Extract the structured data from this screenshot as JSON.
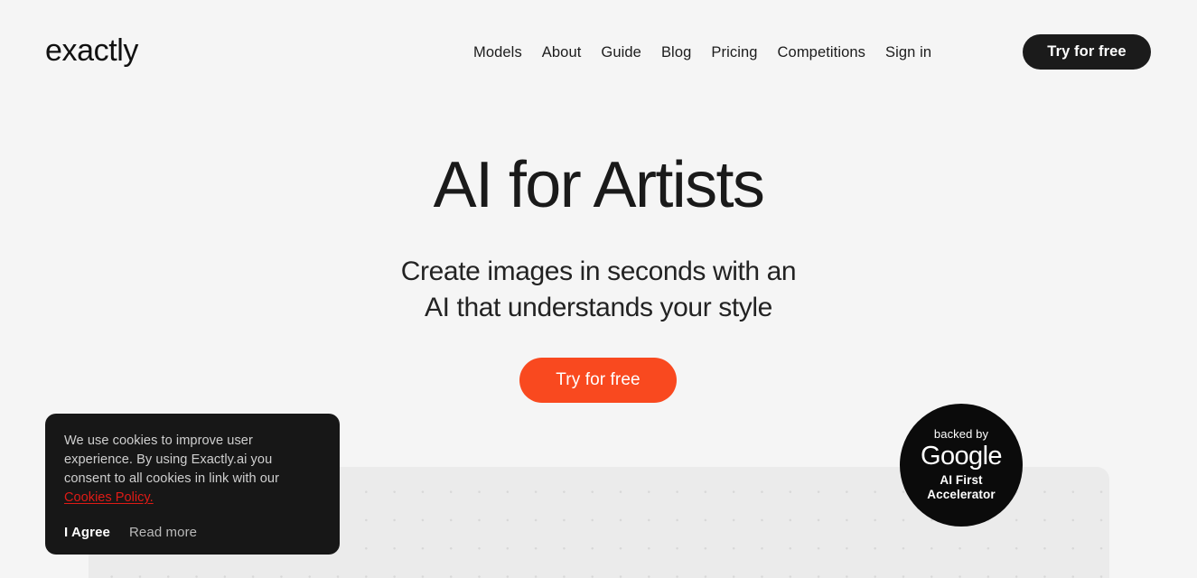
{
  "header": {
    "logo": "exactly",
    "nav_items": [
      {
        "label": "Models"
      },
      {
        "label": "About"
      },
      {
        "label": "Guide"
      },
      {
        "label": "Blog"
      },
      {
        "label": "Pricing"
      },
      {
        "label": "Competitions"
      },
      {
        "label": "Sign in"
      }
    ],
    "cta_label": "Try for free"
  },
  "hero": {
    "title": "AI for Artists",
    "subtitle_line1": "Create images in seconds with an",
    "subtitle_line2": "AI that understands your style",
    "cta_label": "Try for free"
  },
  "badge": {
    "backed_by": "backed by",
    "brand": "Google",
    "program_line1": "AI First",
    "program_line2": "Accelerator"
  },
  "cookie_banner": {
    "text": "We use cookies to improve user experience. By using Exactly.ai you consent to all cookies in link with our",
    "policy_link": "Cookies Policy.",
    "agree_label": "I Agree",
    "read_more_label": "Read more"
  },
  "colors": {
    "page_background": "#f5f5f5",
    "panel_background": "#ebebeb",
    "panel_dot": "#d8d8d8",
    "header_cta_background": "#1b1b1b",
    "hero_cta_background": "#f9491f",
    "cookie_background": "#171717",
    "cookie_link": "#e01b16",
    "text_primary": "#1a1a1a"
  }
}
